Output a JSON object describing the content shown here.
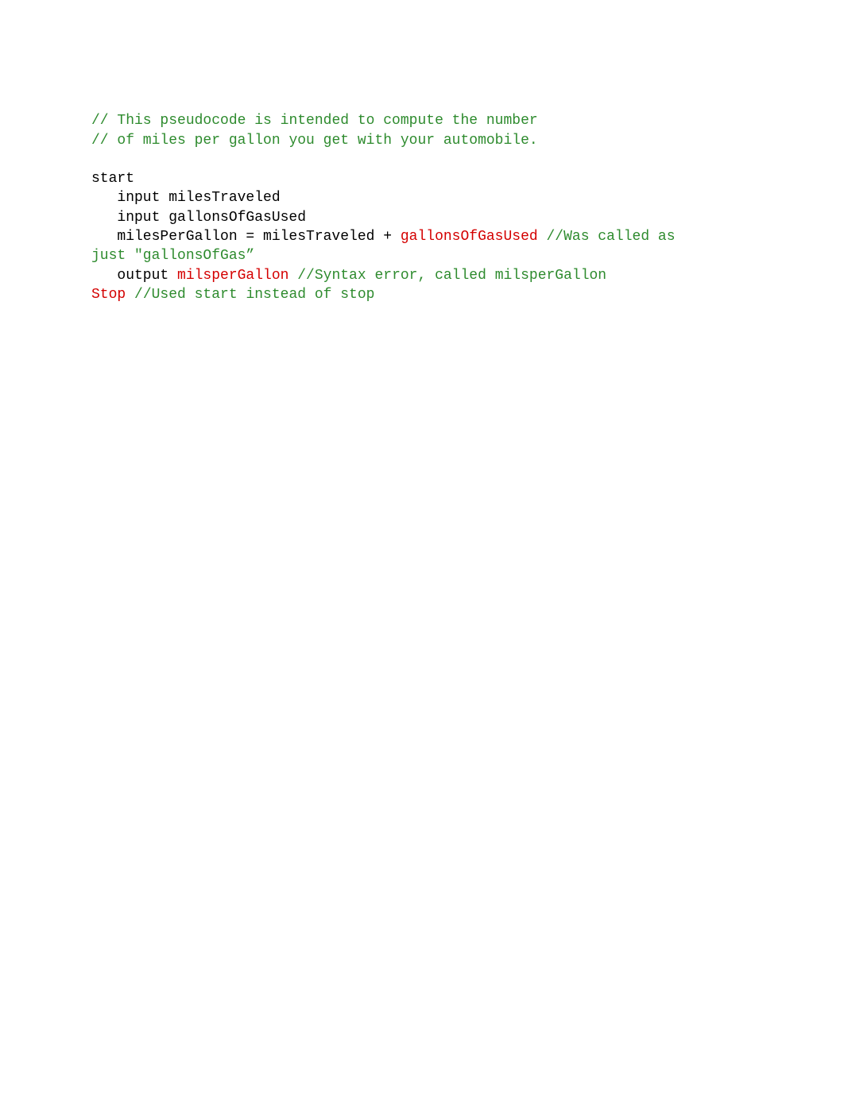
{
  "lines": {
    "comment1": "// This pseudocode is intended to compute the number",
    "comment2": "// of miles per gallon you get with your automobile.",
    "start": "start",
    "input1": "input milesTraveled",
    "input2": "input gallonsOfGasUsed",
    "assign_prefix": "milesPerGallon = milesTraveled + ",
    "assign_error": "gallonsOfGasUsed ",
    "assign_comment_part1": "//Was called as",
    "assign_comment_part2": "just \"gallonsOfGas”",
    "output_prefix": "output ",
    "output_error": "milsperGallon ",
    "output_comment": "//Syntax error, called milsperGallon",
    "stop_error": "Stop ",
    "stop_comment": "//Used start instead of stop"
  }
}
